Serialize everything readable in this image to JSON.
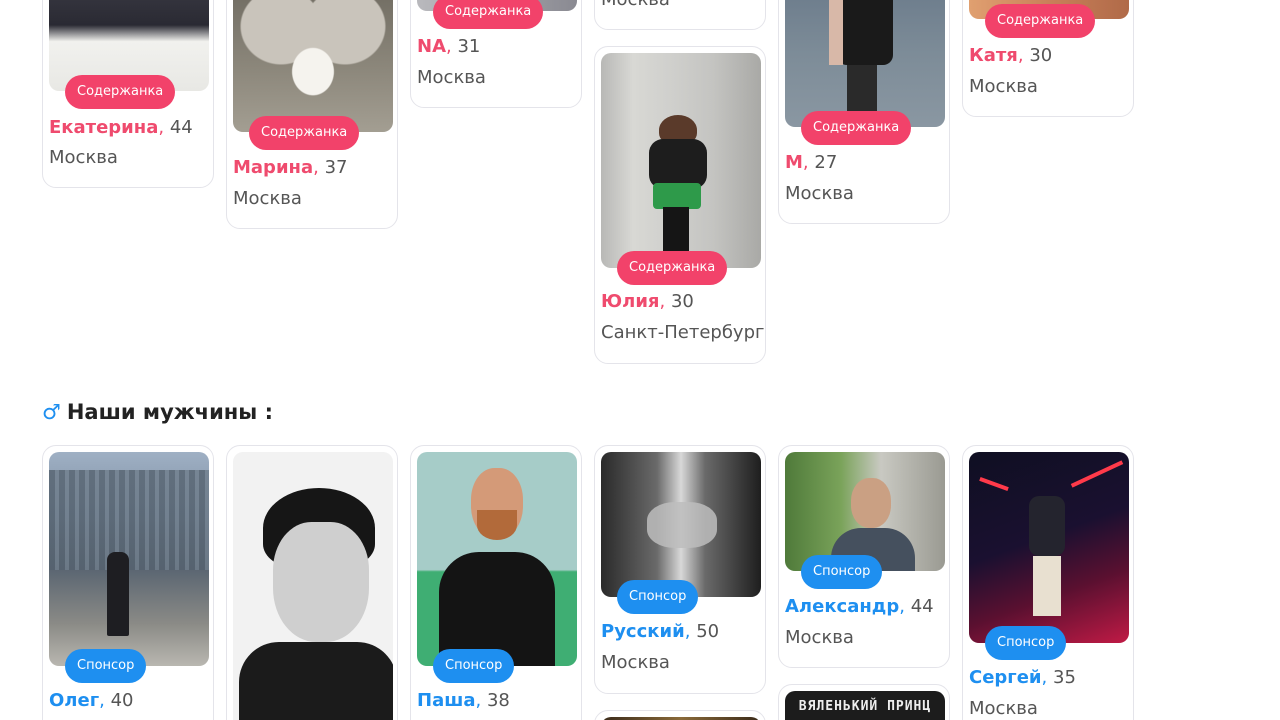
{
  "women": [
    {
      "name": "Екатерина",
      "age": "44",
      "city": "Москва",
      "badge": "Содержанка"
    },
    {
      "name": "Марина",
      "age": "37",
      "city": "Москва",
      "badge": "Содержанка"
    },
    {
      "name": "NA",
      "age": "31",
      "city": "Москва",
      "badge": "Содержанка"
    },
    {
      "city_partial": "Москва"
    },
    {
      "name": "Юлия",
      "age": "30",
      "city": "Санкт-Петербург",
      "badge": "Содержанка"
    },
    {
      "name": "М",
      "age": "27",
      "city": "Москва",
      "badge": "Содержанка"
    },
    {
      "name": "Катя",
      "age": "30",
      "city": "Москва",
      "badge": "Содержанка"
    }
  ],
  "men_section": {
    "symbol": "♂",
    "title": "Наши мужчины :"
  },
  "men": [
    {
      "name": "Олег",
      "age": "40",
      "badge": "Спонсор"
    },
    {},
    {
      "name": "Паша",
      "age": "38",
      "badge": "Спонсор"
    },
    {
      "name": "Русский",
      "age": "50",
      "city": "Москва",
      "badge": "Спонсор"
    },
    {
      "name": "Александр",
      "age": "44",
      "city": "Москва",
      "badge": "Спонсор"
    },
    {
      "name": "Сергей",
      "age": "35",
      "city": "Москва",
      "badge": "Спонсор"
    }
  ],
  "partial_photo_text": "ВЯЛЕНЬКИЙ ПРИНЦ",
  "colors": {
    "women_accent": "#ef4b6e",
    "women_badge": "#f2426a",
    "men_accent": "#1e8ff0"
  }
}
